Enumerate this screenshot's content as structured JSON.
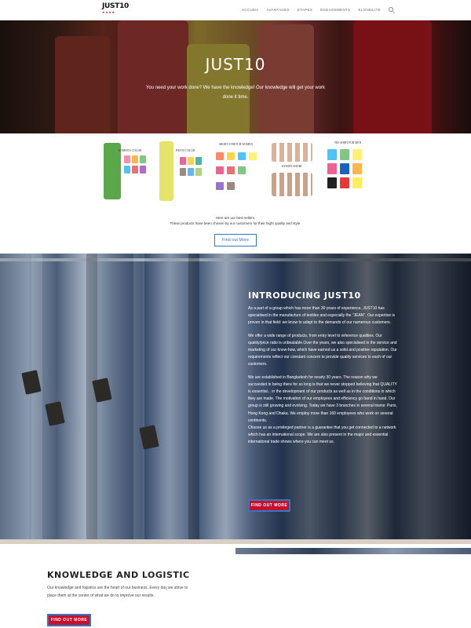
{
  "header": {
    "logo_text": "JUST10",
    "logo_stars": "★★★★",
    "nav": [
      "ACCUEIL",
      "AVANTAGES",
      "ETAPES",
      "ENGAGEMENTS",
      "ELIGIBILITE"
    ]
  },
  "hero": {
    "title": "JUST10",
    "subtitle": "You need your work done? We have the knowledge! Our knowledge will get your work done it time."
  },
  "products": [
    {
      "title": "Women's Color"
    },
    {
      "title": "Pants Color"
    },
    {
      "title": "Short Stretch Women"
    },
    {
      "title": "Women Short"
    },
    {
      "title": "Tee Shirt for Men"
    }
  ],
  "bestsellers": {
    "line1": "Here are our best sellers.",
    "line2": "These products have been chosen by our customers for their hight quality and style.",
    "button": "Find out More"
  },
  "intro": {
    "title": "INTRODUCING JUST10",
    "p1": "As a part of a group which has more than 30 years of experience, JUST10 has specialised in the manufacture of textiles and especially the \"JEAN\". Our expertise is proven in that field: we know to adapt to the demands of our numerous customers.",
    "p2": "We offer a wide range of products, from entry level to reference qualities. Our quality/price ratio is unbeatable.Over the years, we also specialised in the service and marketing of our know-how, which have earned us a solid and positive reputation. Our requirements reflect our constant concern to provide quality services to each of our customers.",
    "p3": "We are established in Bangladesh for nearly 30 years. The reason why we succeeded in being there for so long is that we never stopped believing that QUALITY is essential... in the development of our products as well as in the conditions in which they are made. The motivation of our employees and efficiency go hand in hand. Our group is still growing and evolving. Today we have 3 branches in several towns: Paris, Hong Kong and Dhaka. We employ more than 160 employees who work on several continents.",
    "p4": "Choose us as a privileged partner is a guarantee that you get connected to a network which has an international scope. We are also present in the major and essential international trade shows where you can meet us.",
    "button": "FIND OUT MORE"
  },
  "knowledge": {
    "title": "KNOWLEDGE AND LOGISTIC",
    "text": "Our knowledge and logistics are the heart of our business. Every day we strive to place them at the center of what we do to improve our results.",
    "button": "FIND OUT MORE"
  }
}
